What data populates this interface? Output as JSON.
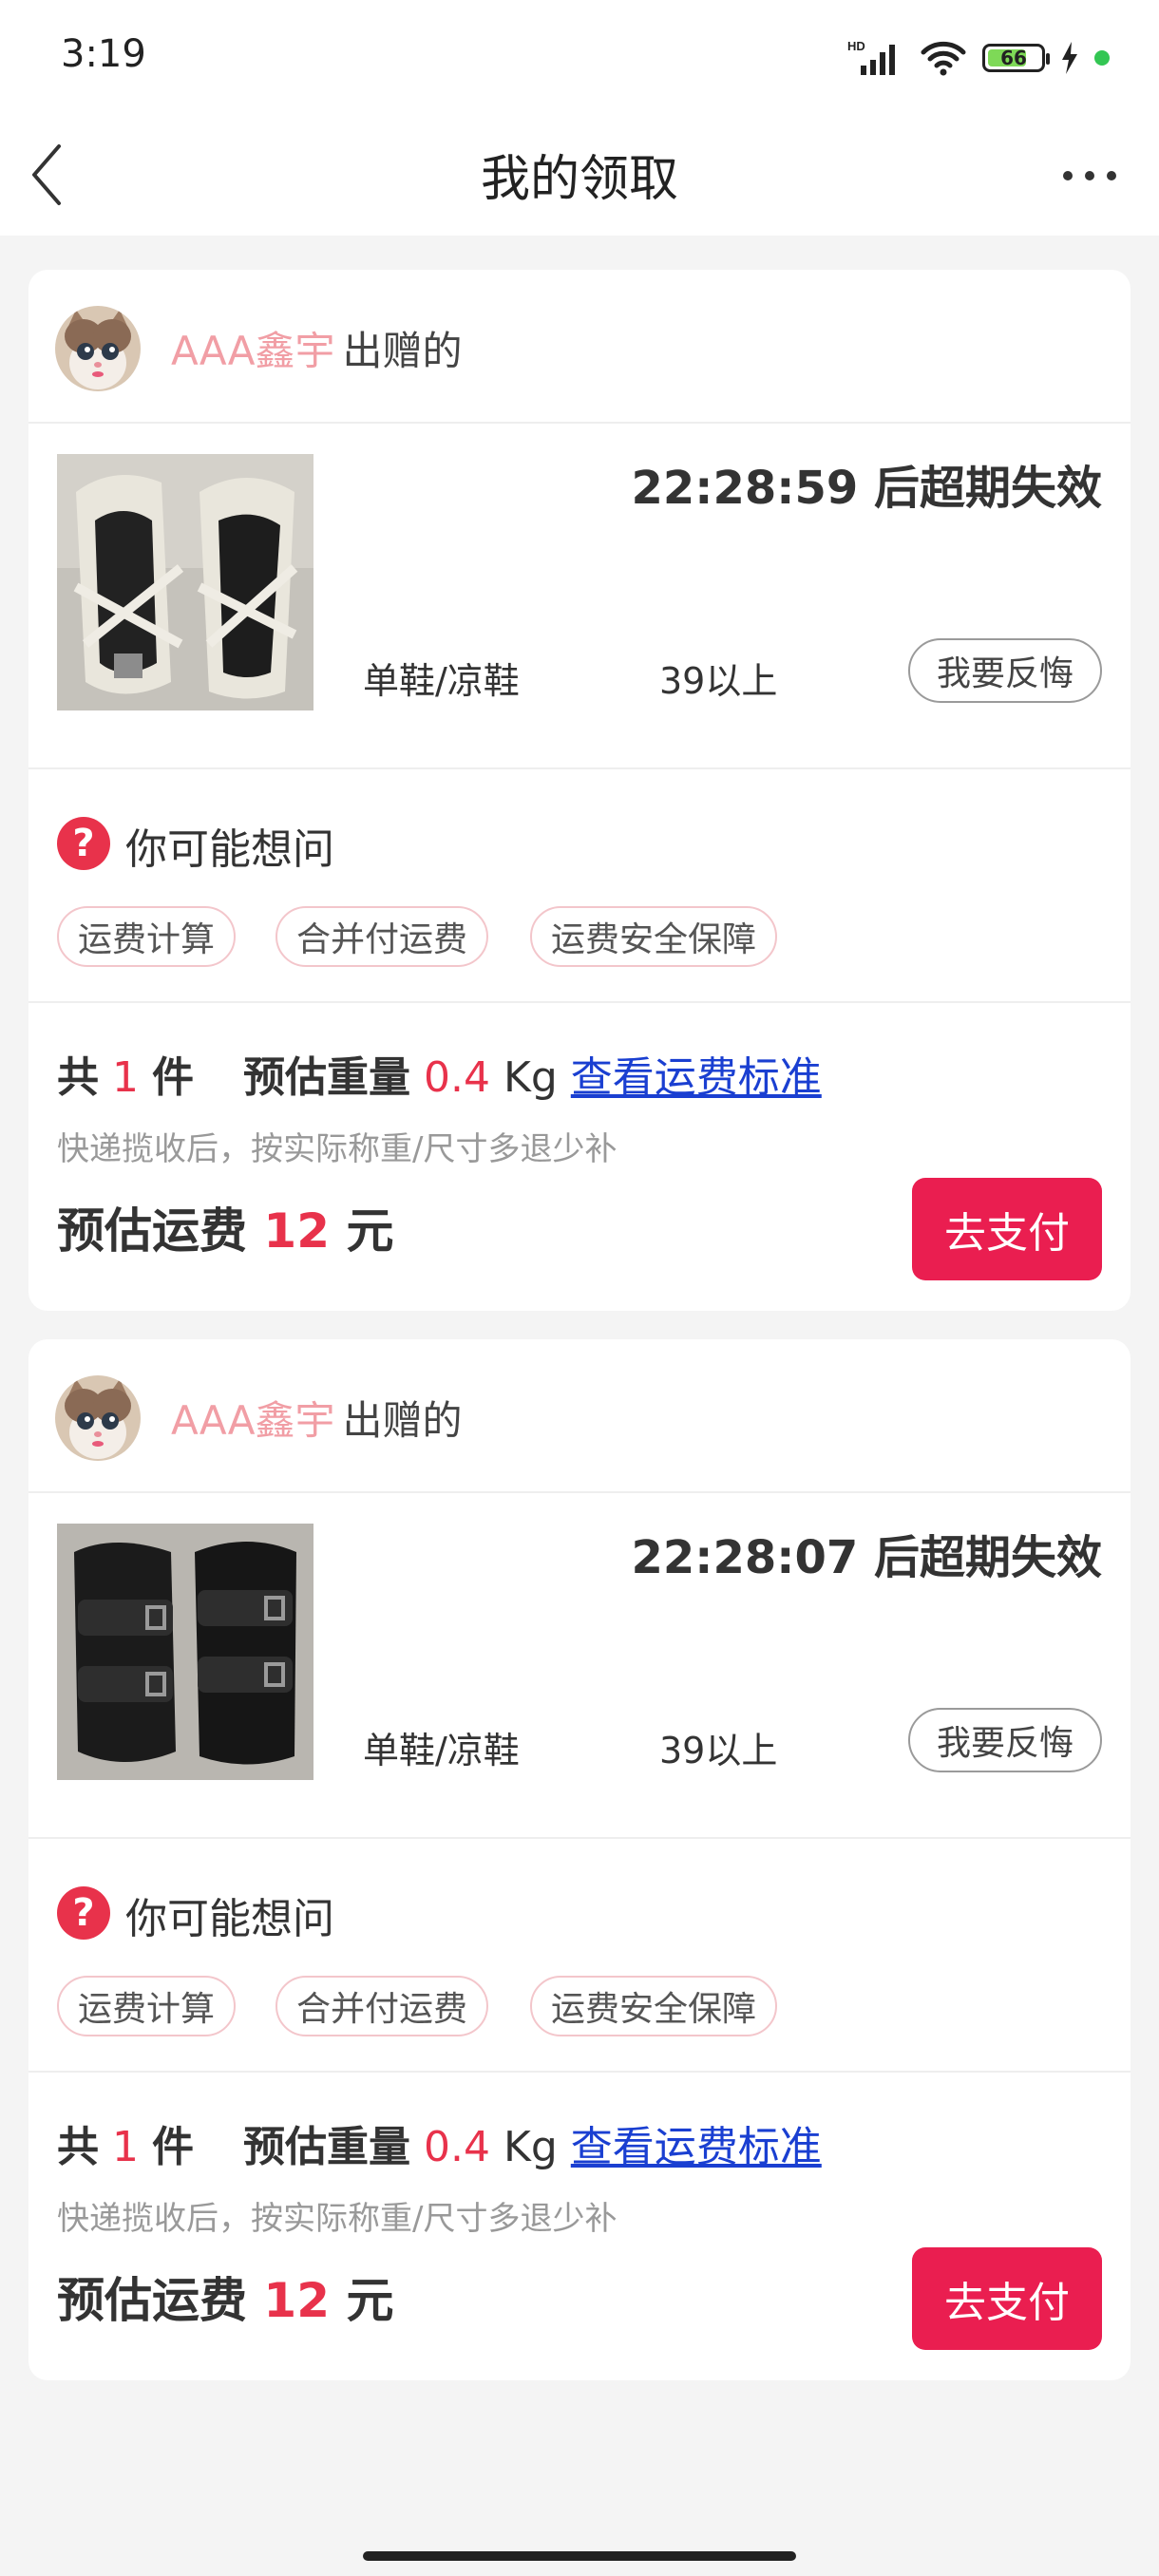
{
  "status": {
    "time": "3:19",
    "battery": "66",
    "net_badge": "HD"
  },
  "nav": {
    "title": "我的领取"
  },
  "colors": {
    "accent": "#ea1e50",
    "link": "#1a3fd1",
    "giver_name": "#f19ea5"
  },
  "cards": [
    {
      "giver_name": "AAA鑫宇",
      "giver_suffix": "出赠的",
      "expire_text": "22:28:59 后超期失效",
      "category": "单鞋/凉鞋",
      "size": "39以上",
      "regret_label": "我要反悔",
      "faq_title": "你可能想问",
      "chips": [
        "运费计算",
        "合并付运费",
        "运费安全保障"
      ],
      "count_prefix": "共",
      "count": "1",
      "count_unit": "件",
      "weight_label": "预估重量",
      "weight_value": "0.4",
      "weight_unit": "Kg",
      "rate_link": "查看运费标准",
      "hint": "快递揽收后，按实际称重/尺寸多退少补",
      "fee_label": "预估运费",
      "fee_value": "12",
      "fee_unit": "元",
      "pay_label": "去支付"
    },
    {
      "giver_name": "AAA鑫宇",
      "giver_suffix": "出赠的",
      "expire_text": "22:28:07 后超期失效",
      "category": "单鞋/凉鞋",
      "size": "39以上",
      "regret_label": "我要反悔",
      "faq_title": "你可能想问",
      "chips": [
        "运费计算",
        "合并付运费",
        "运费安全保障"
      ],
      "count_prefix": "共",
      "count": "1",
      "count_unit": "件",
      "weight_label": "预估重量",
      "weight_value": "0.4",
      "weight_unit": "Kg",
      "rate_link": "查看运费标准",
      "hint": "快递揽收后，按实际称重/尺寸多退少补",
      "fee_label": "预估运费",
      "fee_value": "12",
      "fee_unit": "元",
      "pay_label": "去支付"
    }
  ]
}
